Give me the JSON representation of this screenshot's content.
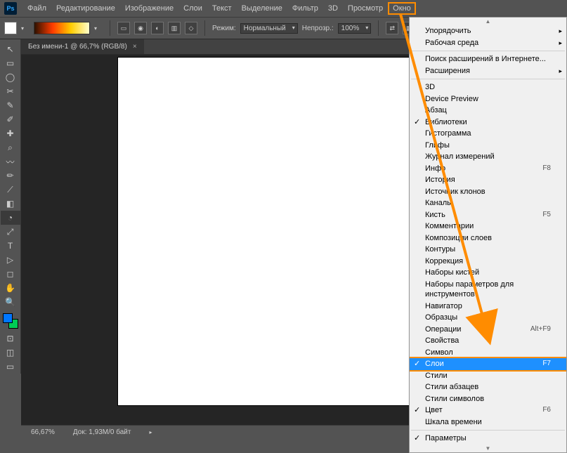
{
  "app": {
    "logo": "Ps"
  },
  "menubar": {
    "items": [
      "Файл",
      "Редактирование",
      "Изображение",
      "Слои",
      "Текст",
      "Выделение",
      "Фильтр",
      "3D",
      "Просмотр",
      "Окно"
    ],
    "outlined_index": 9
  },
  "optbar": {
    "mode_label": "Режим:",
    "mode_value": "Нормальный",
    "opacity_label": "Непрозр.:",
    "opacity_value": "100%"
  },
  "tab": {
    "title": "Без имени-1 @ 66,7% (RGB/8)",
    "close": "×"
  },
  "dropdown": {
    "groups": [
      [
        {
          "label": "Упорядочить",
          "sub": true
        },
        {
          "label": "Рабочая среда",
          "sub": true
        }
      ],
      [
        {
          "label": "Поиск расширений в Интернете..."
        },
        {
          "label": "Расширения",
          "sub": true
        }
      ],
      [
        {
          "label": "3D"
        },
        {
          "label": "Device Preview"
        },
        {
          "label": "Абзац"
        },
        {
          "label": "Библиотеки",
          "check": true
        },
        {
          "label": "Гистограмма"
        },
        {
          "label": "Глифы"
        },
        {
          "label": "Журнал измерений"
        },
        {
          "label": "Инфо",
          "shortcut": "F8"
        },
        {
          "label": "История"
        },
        {
          "label": "Источник клонов"
        },
        {
          "label": "Каналы"
        },
        {
          "label": "Кисть",
          "shortcut": "F5"
        },
        {
          "label": "Комментарии"
        },
        {
          "label": "Композиции слоев"
        },
        {
          "label": "Контуры"
        },
        {
          "label": "Коррекция"
        },
        {
          "label": "Наборы кистей"
        },
        {
          "label": "Наборы параметров для инструментов"
        },
        {
          "label": "Навигатор"
        },
        {
          "label": "Образцы"
        },
        {
          "label": "Операции",
          "shortcut": "Alt+F9"
        },
        {
          "label": "Свойства"
        },
        {
          "label": "Символ"
        },
        {
          "label": "Слои",
          "shortcut": "F7",
          "check": true,
          "highlight": true
        },
        {
          "label": "Стили"
        },
        {
          "label": "Стили абзацев"
        },
        {
          "label": "Стили символов"
        },
        {
          "label": "Цвет",
          "shortcut": "F6",
          "check": true
        },
        {
          "label": "Шкала времени"
        }
      ],
      [
        {
          "label": "Параметры",
          "check": true
        }
      ]
    ]
  },
  "status": {
    "zoom": "66,67%",
    "doc": "Док: 1,93M/0 байт"
  },
  "tools": [
    "↖",
    "▭",
    "◯",
    "✂",
    "✎",
    "✐",
    "✚",
    "⌕",
    "〰",
    "✏",
    "⟋",
    "◧",
    "◔",
    "⤢",
    "T",
    "▷",
    "◻",
    "✋",
    "🔍"
  ]
}
